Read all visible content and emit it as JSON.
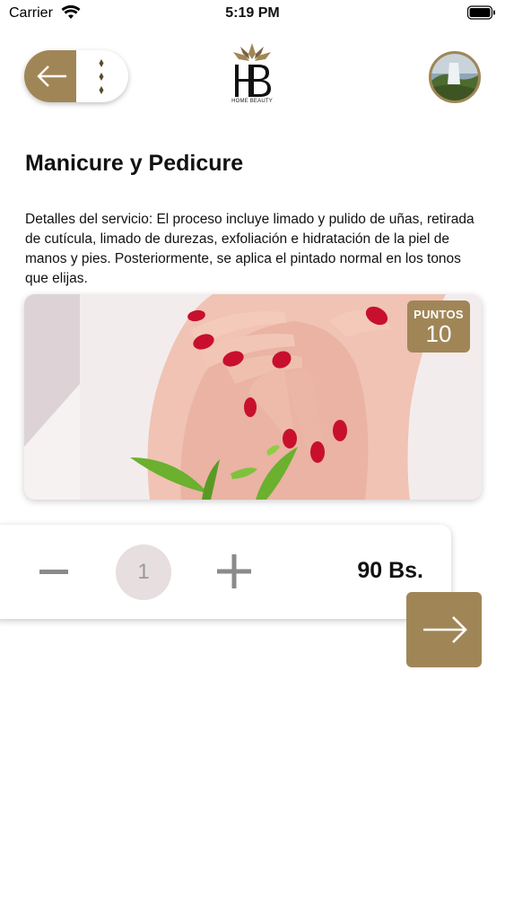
{
  "status_bar": {
    "carrier": "Carrier",
    "time": "5:19 PM"
  },
  "header": {
    "logo_text": "HOME BEAUTY",
    "logo_monogram": "HB"
  },
  "service": {
    "title": "Manicure y Pedicure",
    "description": "Detalles del servicio: El proceso incluye limado y pulido de uñas, retirada de cutícula, limado de durezas, exfoliación e hidratación de la piel de manos y pies. Posteriormente, se aplica el pintado normal en los tonos que elijas.",
    "points_label": "PUNTOS",
    "points_value": "10"
  },
  "order": {
    "quantity": "1",
    "price": "90 Bs."
  },
  "colors": {
    "accent": "#a08657",
    "qty_circle": "#e6dedf",
    "nail_red": "#c8102e"
  },
  "icons": [
    "wifi-icon",
    "battery-icon",
    "back-arrow-icon",
    "menu-dots-icon",
    "minus-icon",
    "plus-icon",
    "arrow-right-icon"
  ]
}
